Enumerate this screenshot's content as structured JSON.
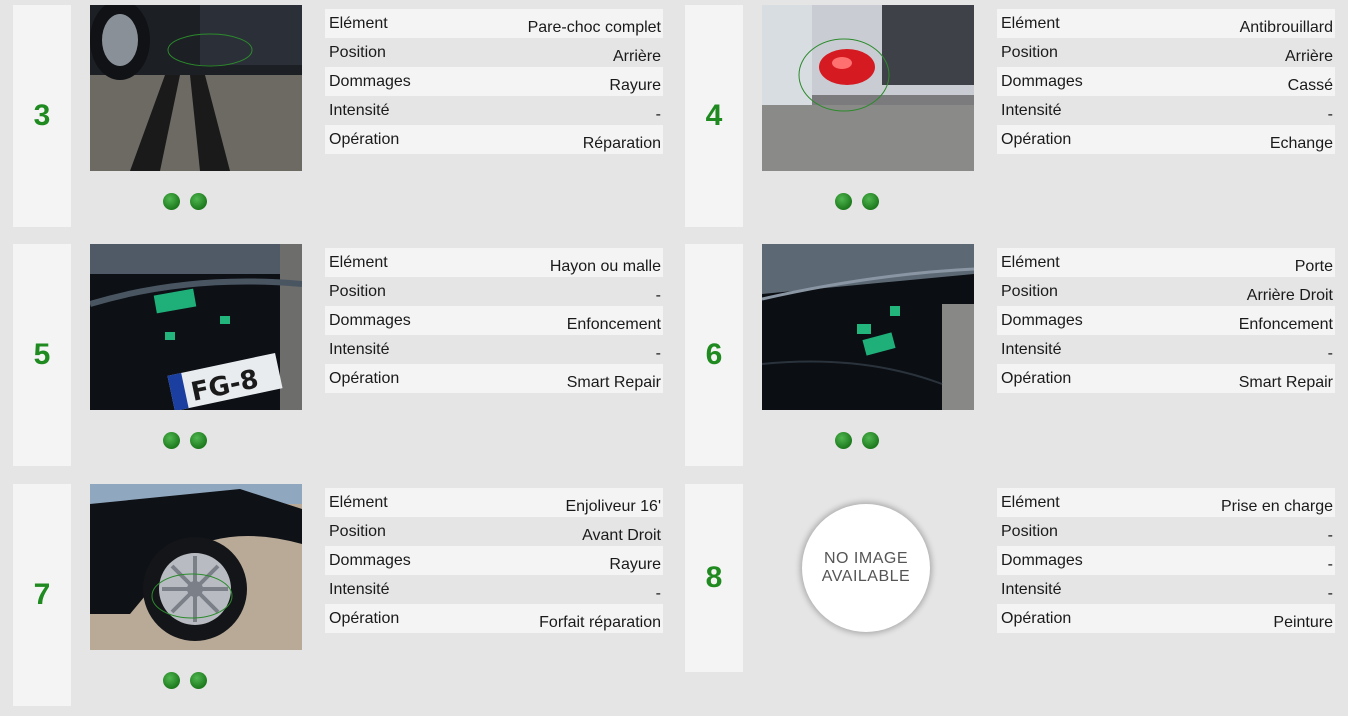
{
  "labels": {
    "element": "Elément",
    "position": "Position",
    "dommages": "Dommages",
    "intensite": "Intensité",
    "operation": "Opération"
  },
  "no_image": {
    "line1": "NO IMAGE",
    "line2": "AVAILABLE"
  },
  "cards": [
    {
      "number": "3",
      "element": "Pare-choc complet",
      "position": "Arrière",
      "dommages": "Rayure",
      "intensite": "-",
      "operation": "Réparation",
      "photo_icon": "rear-bumper-photo"
    },
    {
      "number": "4",
      "element": "Antibrouillard",
      "position": "Arrière",
      "dommages": "Cassé",
      "intensite": "-",
      "operation": "Echange",
      "photo_icon": "fog-light-photo"
    },
    {
      "number": "5",
      "element": "Hayon ou malle",
      "position": "-",
      "dommages": "Enfoncement",
      "intensite": "-",
      "operation": "Smart Repair",
      "photo_icon": "tailgate-photo"
    },
    {
      "number": "6",
      "element": "Porte",
      "position": "Arrière Droit",
      "dommages": "Enfoncement",
      "intensite": "-",
      "operation": "Smart Repair",
      "photo_icon": "door-photo"
    },
    {
      "number": "7",
      "element": "Enjoliveur 16'",
      "position": "Avant Droit",
      "dommages": "Rayure",
      "intensite": "-",
      "operation": "Forfait réparation",
      "photo_icon": "wheel-cover-photo"
    },
    {
      "number": "8",
      "element": "Prise en charge",
      "position": "-",
      "dommages": "-",
      "intensite": "-",
      "operation": "Peinture",
      "photo_icon": "no-image-placeholder"
    }
  ],
  "colors": {
    "accent_green": "#1f8a1f",
    "background": "#e5e5e5",
    "row_light": "#f4f4f4"
  }
}
